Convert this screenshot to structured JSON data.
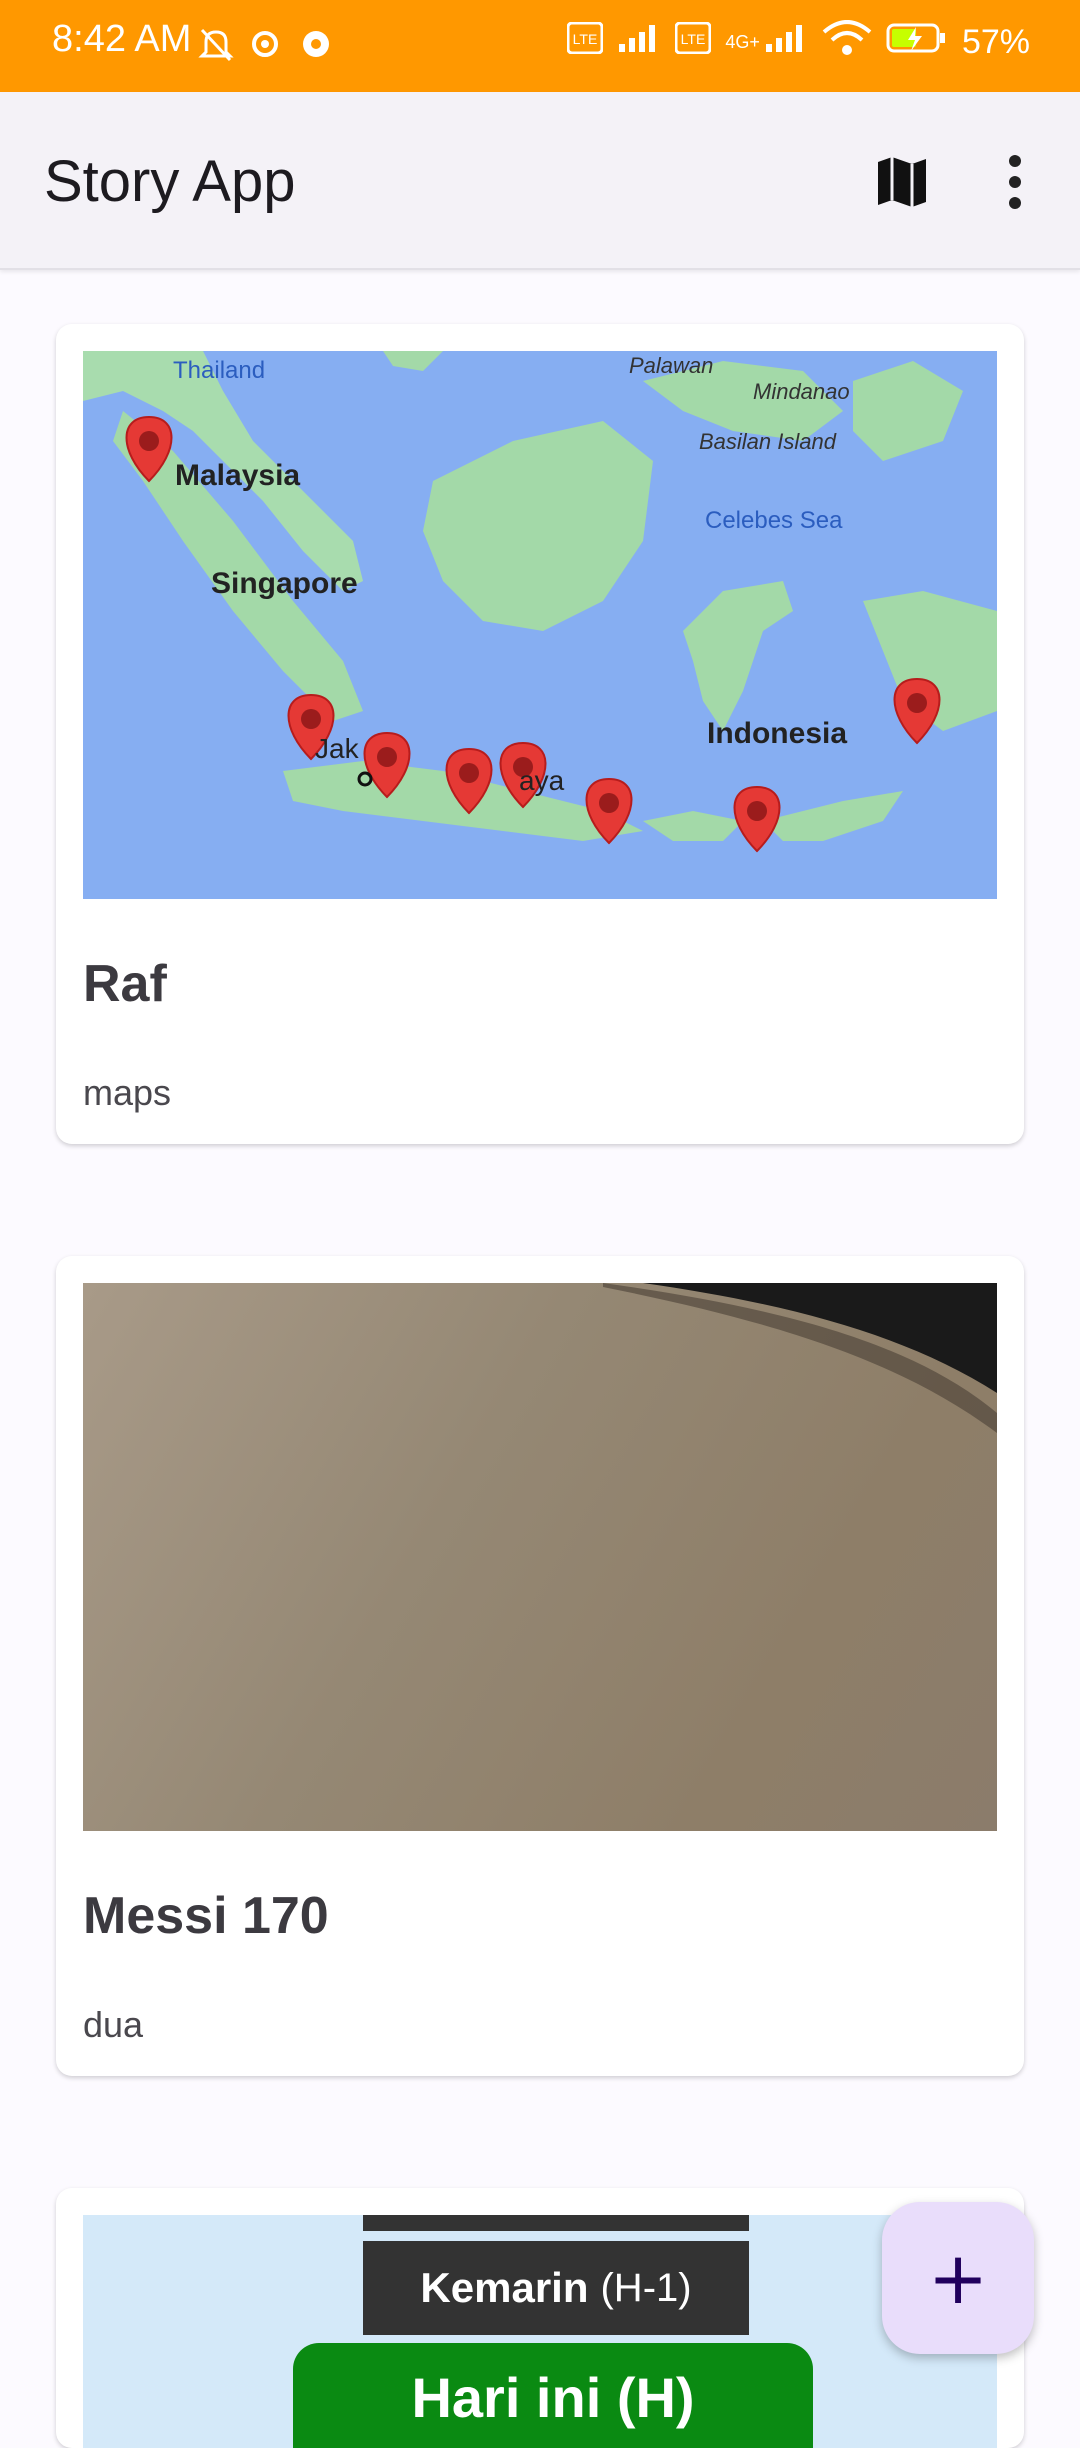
{
  "status_bar": {
    "time": "8:42 AM",
    "battery": "57%",
    "network": "4G+",
    "icons": [
      "mute-icon",
      "settings-icon",
      "gear-icon",
      "volte-icon",
      "signal-icon",
      "volte-icon",
      "signal-icon",
      "wifi-icon",
      "battery-charging-icon"
    ]
  },
  "app_bar": {
    "title": "Story App",
    "actions": [
      "map-icon",
      "more-vert-icon"
    ]
  },
  "stories": [
    {
      "name": "Raf",
      "description": "maps",
      "map_labels": [
        "Thailand",
        "Malaysia",
        "Singapore",
        "Palawan",
        "Mindanao",
        "Basilan Island",
        "Celebes Sea",
        "Indonesia",
        "Jak",
        "aya"
      ]
    },
    {
      "name": "Messi 170",
      "description": "dua"
    },
    {
      "name": "",
      "description": "",
      "image_text": {
        "yesterday": "Kemarin",
        "yesterday_tag": "(H-1)",
        "today": "Hari ini (H)"
      }
    }
  ],
  "fab": {
    "label": "+"
  },
  "colors": {
    "status_bar": "#FF9800",
    "fab_bg": "#E9DDFB",
    "map_water": "#7FA8F0",
    "map_land": "#A3D9A8",
    "marker": "#E53935"
  }
}
